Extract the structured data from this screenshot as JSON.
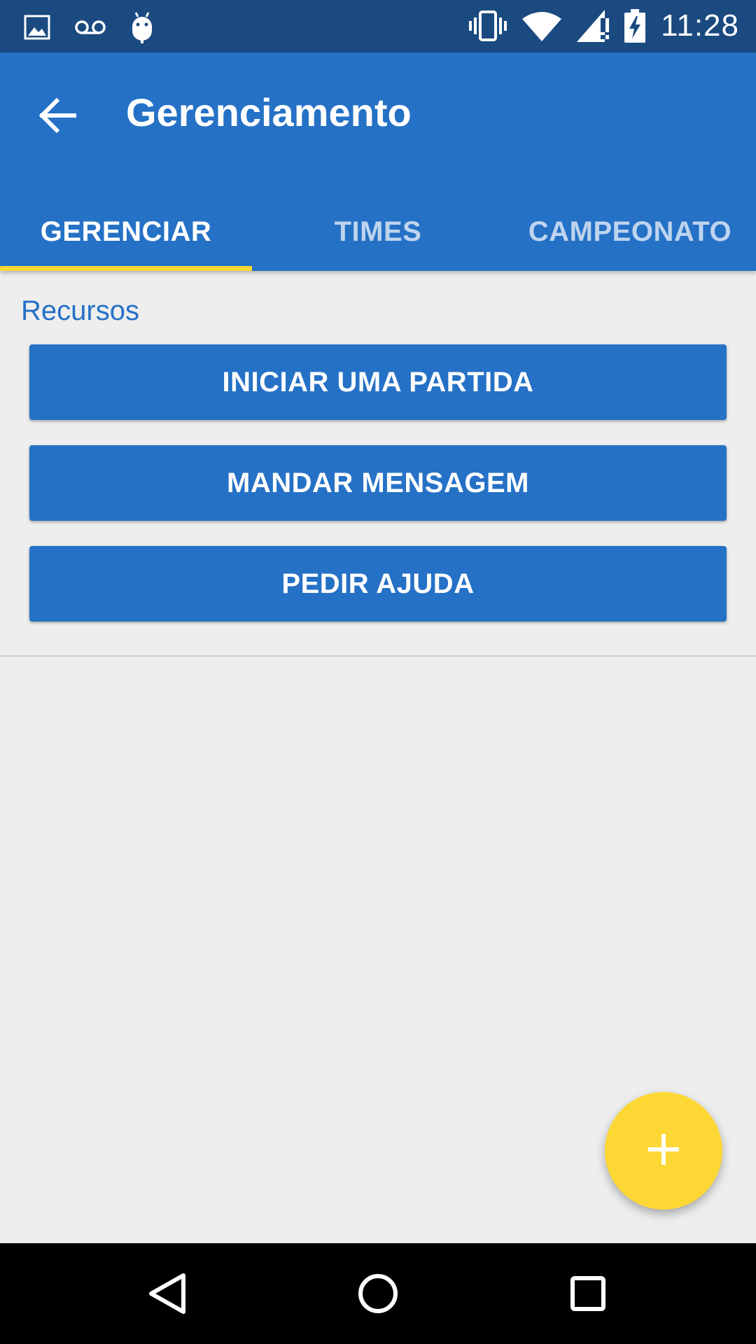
{
  "status_bar": {
    "time": "11:28",
    "icons_left": [
      "image-icon",
      "voicemail-icon",
      "android-icon"
    ],
    "icons_right": [
      "vibrate-icon",
      "wifi-icon",
      "signal-icon",
      "battery-charging-icon"
    ]
  },
  "app_bar": {
    "title": "Gerenciamento",
    "back_icon": "arrow-back-icon"
  },
  "tabs": [
    {
      "label": "GERENCIAR",
      "active": true
    },
    {
      "label": "TIMES",
      "active": false
    },
    {
      "label": "CAMPEONATO",
      "active": false
    }
  ],
  "main": {
    "section_title": "Recursos",
    "buttons": [
      {
        "label": "INICIAR UMA PARTIDA"
      },
      {
        "label": "MANDAR MENSAGEM"
      },
      {
        "label": "PEDIR AJUDA"
      }
    ]
  },
  "fab": {
    "icon": "plus-icon"
  },
  "nav_bar": {
    "icons": [
      "back-triangle-icon",
      "home-circle-icon",
      "recents-square-icon"
    ]
  },
  "colors": {
    "status_bar": "#1a4a80",
    "primary": "#2571c6",
    "accent": "#fdd835",
    "background": "#eeeeee"
  }
}
